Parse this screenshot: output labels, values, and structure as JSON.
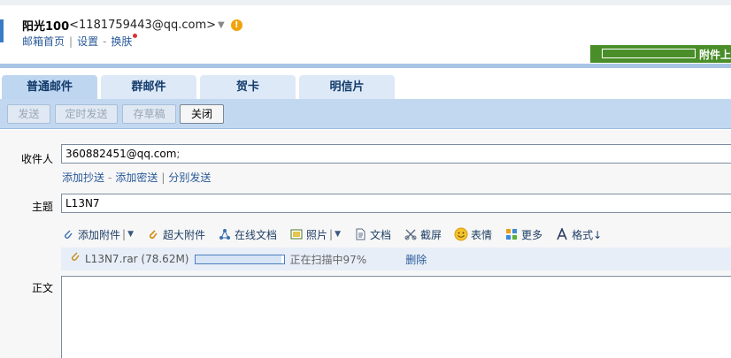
{
  "header": {
    "user_name": "阳光100",
    "user_email": "<1181759443@qq.com>",
    "dropdown_glyph": "▼",
    "alert_glyph": "!",
    "nav": {
      "home": "邮箱首页",
      "sep": "|",
      "settings": "设置",
      "dash": "-",
      "switch": "换肤"
    },
    "upload_label": "附件上"
  },
  "tabs": [
    {
      "label": "普通邮件"
    },
    {
      "label": "群邮件"
    },
    {
      "label": "贺卡"
    },
    {
      "label": "明信片"
    }
  ],
  "toolbar": {
    "send": "发送",
    "scheduled_send": "定时发送",
    "save_draft": "存草稿",
    "close": "关闭"
  },
  "form": {
    "to_label": "收件人",
    "to_value": "360882451@qq.com",
    "to_separator": ";",
    "links": {
      "cc": "添加抄送",
      "dash": "-",
      "bcc": "添加密送",
      "sep": "|",
      "separate": "分别发送"
    },
    "subject_label": "主题",
    "subject_value": "L13N7",
    "body_label": "正文"
  },
  "attach_tools": {
    "add_attachment": "添加附件",
    "large_attachment": "超大附件",
    "online_doc": "在线文档",
    "photo": "照片",
    "doc": "文档",
    "screenshot": "截屏",
    "emoticon": "表情",
    "more": "更多",
    "format": "格式↓",
    "pipe": "|",
    "caret": "▼"
  },
  "attachment": {
    "file_name": "L13N7.rar (78.62M)",
    "status": "正在扫描中97%",
    "scan_progress_percent": 97,
    "delete_label": "删除"
  },
  "colors": {
    "accent": "#2a5a9a",
    "upload_green": "#4a8e2a",
    "toolbar_blue": "#c2d8f0"
  },
  "icons": {
    "paperclip": "paperclip-icon",
    "large_clip": "large-attachment-icon",
    "share": "share-nodes-icon",
    "photo": "photo-icon",
    "doc": "document-icon",
    "screenshot": "scissors-icon",
    "emoticon": "smiley-icon",
    "more": "grid-icon",
    "format": "font-a-icon"
  }
}
